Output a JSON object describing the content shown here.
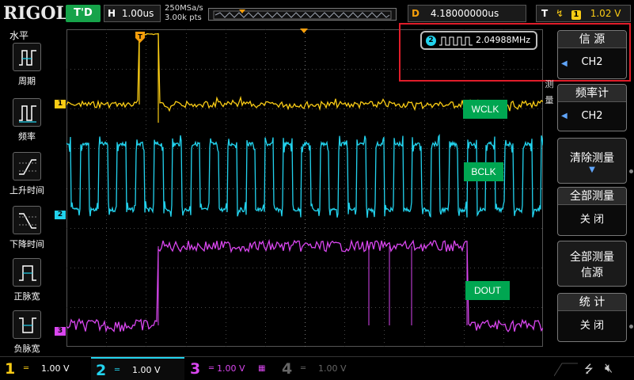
{
  "topbar": {
    "brand": "RIGOL",
    "run_status": "T'D",
    "timebase_label": "H",
    "timebase_value": "1.00us",
    "sample_rate": "250MSa/s",
    "memory_depth": "3.00k pts",
    "delay_label": "D",
    "delay_value": "4.18000000us",
    "trigger_label": "T",
    "trigger_source": "1",
    "trigger_level": "1.02 V"
  },
  "leftbar": {
    "title": "水平",
    "items": [
      {
        "label": "周期",
        "icon": "period-icon"
      },
      {
        "label": "频率",
        "icon": "frequency-icon"
      },
      {
        "label": "上升时间",
        "icon": "rise-time-icon"
      },
      {
        "label": "下降时间",
        "icon": "fall-time-icon"
      },
      {
        "label": "正脉宽",
        "icon": "positive-width-icon"
      },
      {
        "label": "负脉宽",
        "icon": "negative-width-icon"
      }
    ]
  },
  "measurement": {
    "channel": "2",
    "value": "2.04988MHz"
  },
  "annotations": {
    "wclk": "WCLK",
    "bclk": "BCLK",
    "dout": "DOUT"
  },
  "channel_markers": {
    "ch1": "1",
    "ch2": "2",
    "ch3": "3"
  },
  "rightmenu": {
    "side_label_1": "测",
    "side_label_2": "量",
    "source": {
      "title": "信 源",
      "value": "CH2"
    },
    "counter": {
      "title": "频率计",
      "value": "CH2"
    },
    "clear": {
      "title": "清除测量"
    },
    "all_measure": {
      "title": "全部测量",
      "value": "关 闭"
    },
    "all_source": {
      "title_line1": "全部测量",
      "title_line2": "信源"
    },
    "stats": {
      "title": "统 计",
      "value": "关 闭"
    }
  },
  "bottombar": {
    "channels": [
      {
        "num": "1",
        "value": "1.00 V",
        "color": "#facc15"
      },
      {
        "num": "2",
        "value": "1.00 V",
        "color": "#22d3ee"
      },
      {
        "num": "3",
        "value": "1.00 V",
        "color": "#d946ef"
      },
      {
        "num": "4",
        "value": "1.00 V",
        "color": "#666666"
      }
    ],
    "usb_icon": "usb-icon",
    "speaker_icon": "speaker-mute-icon"
  },
  "colors": {
    "ch1": "#facc15",
    "ch2": "#22d3ee",
    "ch3": "#d946ef",
    "ch4": "#666666",
    "trigger_marker": "#f59e0b",
    "highlight_box": "#e11d2a",
    "annotation_bg": "#00a651"
  }
}
